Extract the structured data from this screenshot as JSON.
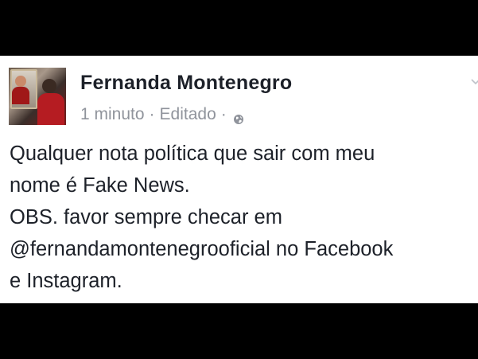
{
  "post": {
    "author": "Fernanda Montenegro",
    "time": "1 minuto",
    "separator": "·",
    "edited": "Editado",
    "privacy_icon": "globe-icon",
    "menu_icon": "chevron-down-icon",
    "text_lines": [
      "Qualquer nota política que sair com meu",
      "nome é Fake News.",
      "OBS. favor sempre checar em",
      "@fernandamontenegrooficial no Facebook",
      "e Instagram."
    ]
  },
  "colors": {
    "background": "#000000",
    "card": "#ffffff",
    "author": "#1d2129",
    "meta": "#90949c"
  }
}
